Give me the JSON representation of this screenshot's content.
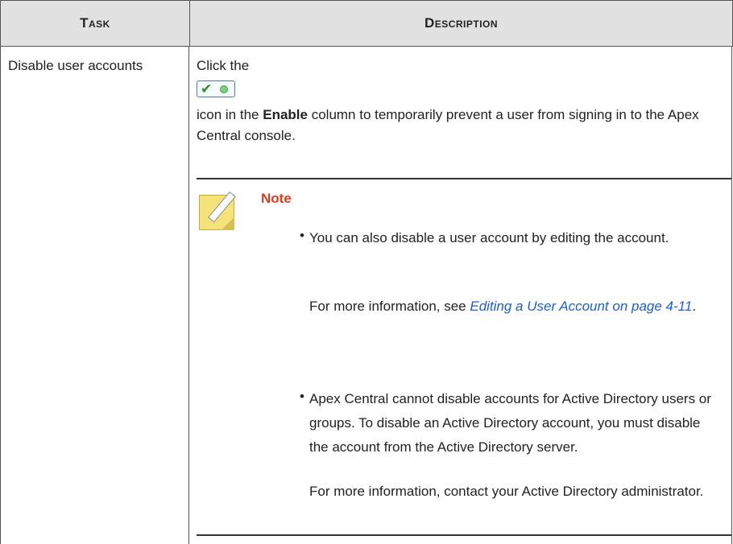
{
  "table": {
    "headers": {
      "task": "Task",
      "description": "Description"
    },
    "rows": [
      {
        "task": "Disable user accounts",
        "description": {
          "line1": "Click the",
          "icon": "enable-toggle-icon",
          "para_pre": "icon in the ",
          "para_bold": "Enable",
          "para_post": " column to temporarily prevent a user from signing in to the Apex Central console."
        }
      }
    ]
  },
  "note": {
    "title": "Note",
    "items": [
      {
        "text": "You can also disable a user account by editing the account.",
        "more_pre": "For more information, see ",
        "more_link": "Editing a User Account on page 4-11",
        "more_post": "."
      },
      {
        "text": "Apex Central cannot disable accounts for Active Directory users or groups. To disable an Active Directory account, you must disable the account from the Active Directory server.",
        "more": "For more information, contact your Active Directory administrator."
      }
    ]
  },
  "colors": {
    "header_bg": "#e1e1e1",
    "note_title": "#e23a1b",
    "link": "#1a5fd0"
  }
}
